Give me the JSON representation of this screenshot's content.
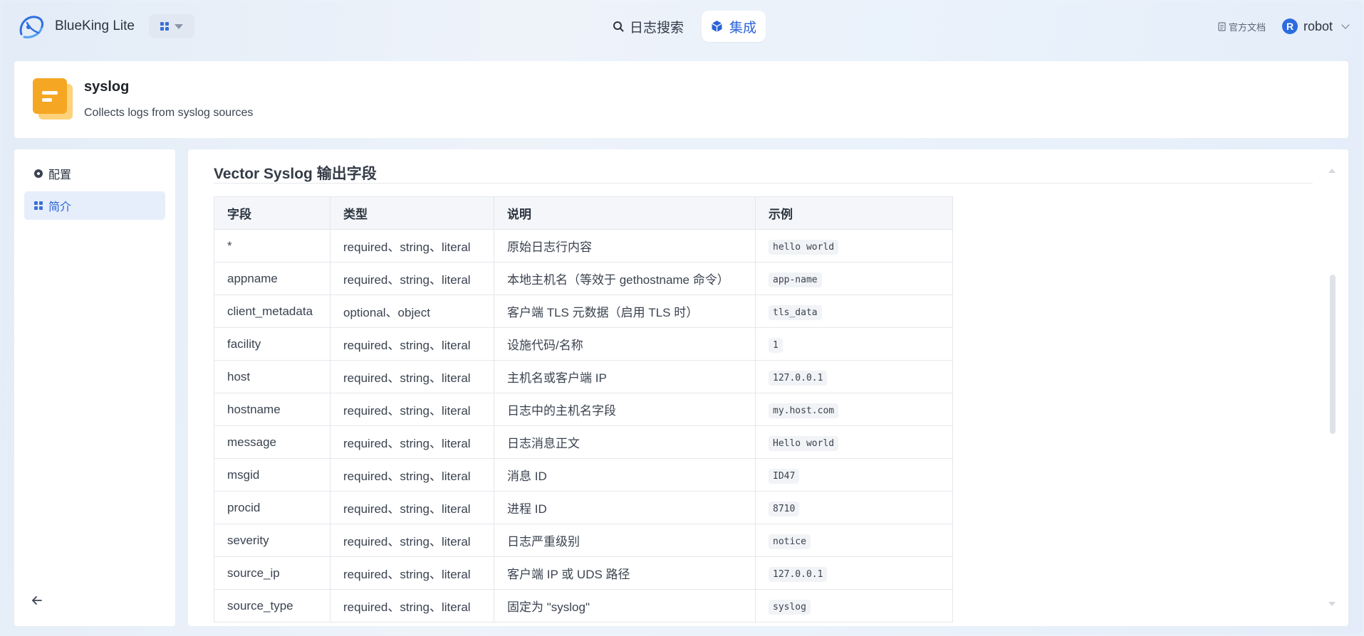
{
  "header": {
    "app_title": "BlueKing Lite",
    "nav": {
      "search_label": "日志搜索",
      "integrate_label": "集成"
    },
    "docs_label": "官方文档",
    "user": {
      "initial": "R",
      "name": "robot"
    }
  },
  "source": {
    "name": "syslog",
    "description": "Collects logs from syslog sources"
  },
  "sidebar": {
    "items": [
      {
        "label": "配置",
        "icon": "gear-icon",
        "active": false
      },
      {
        "label": "简介",
        "icon": "grid-icon",
        "active": true
      }
    ]
  },
  "main": {
    "section_title": "Vector Syslog 输出字段",
    "table": {
      "headers": [
        "字段",
        "类型",
        "说明",
        "示例"
      ],
      "rows": [
        {
          "field": "*",
          "type": "required、string、literal",
          "desc": "原始日志行内容",
          "example": "hello world"
        },
        {
          "field": "appname",
          "type": "required、string、literal",
          "desc": "本地主机名（等效于 gethostname 命令）",
          "example": "app-name"
        },
        {
          "field": "client_metadata",
          "type": "optional、object",
          "desc": "客户端 TLS 元数据（启用 TLS 时）",
          "example": "tls_data"
        },
        {
          "field": "facility",
          "type": "required、string、literal",
          "desc": "设施代码/名称",
          "example": "1"
        },
        {
          "field": "host",
          "type": "required、string、literal",
          "desc": "主机名或客户端 IP",
          "example": "127.0.0.1"
        },
        {
          "field": "hostname",
          "type": "required、string、literal",
          "desc": "日志中的主机名字段",
          "example": "my.host.com"
        },
        {
          "field": "message",
          "type": "required、string、literal",
          "desc": "日志消息正文",
          "example": "Hello world"
        },
        {
          "field": "msgid",
          "type": "required、string、literal",
          "desc": "消息 ID",
          "example": "ID47"
        },
        {
          "field": "procid",
          "type": "required、string、literal",
          "desc": "进程 ID",
          "example": "8710"
        },
        {
          "field": "severity",
          "type": "required、string、literal",
          "desc": "日志严重级别",
          "example": "notice"
        },
        {
          "field": "source_ip",
          "type": "required、string、literal",
          "desc": "客户端 IP 或 UDS 路径",
          "example": "127.0.0.1"
        },
        {
          "field": "source_type",
          "type": "required、string、literal",
          "desc": "固定为 \"syslog\"",
          "example": "syslog"
        }
      ]
    }
  },
  "colors": {
    "accent": "#2a63d8",
    "active_bg": "#e6eefb",
    "source_icon": "#f5a623"
  }
}
